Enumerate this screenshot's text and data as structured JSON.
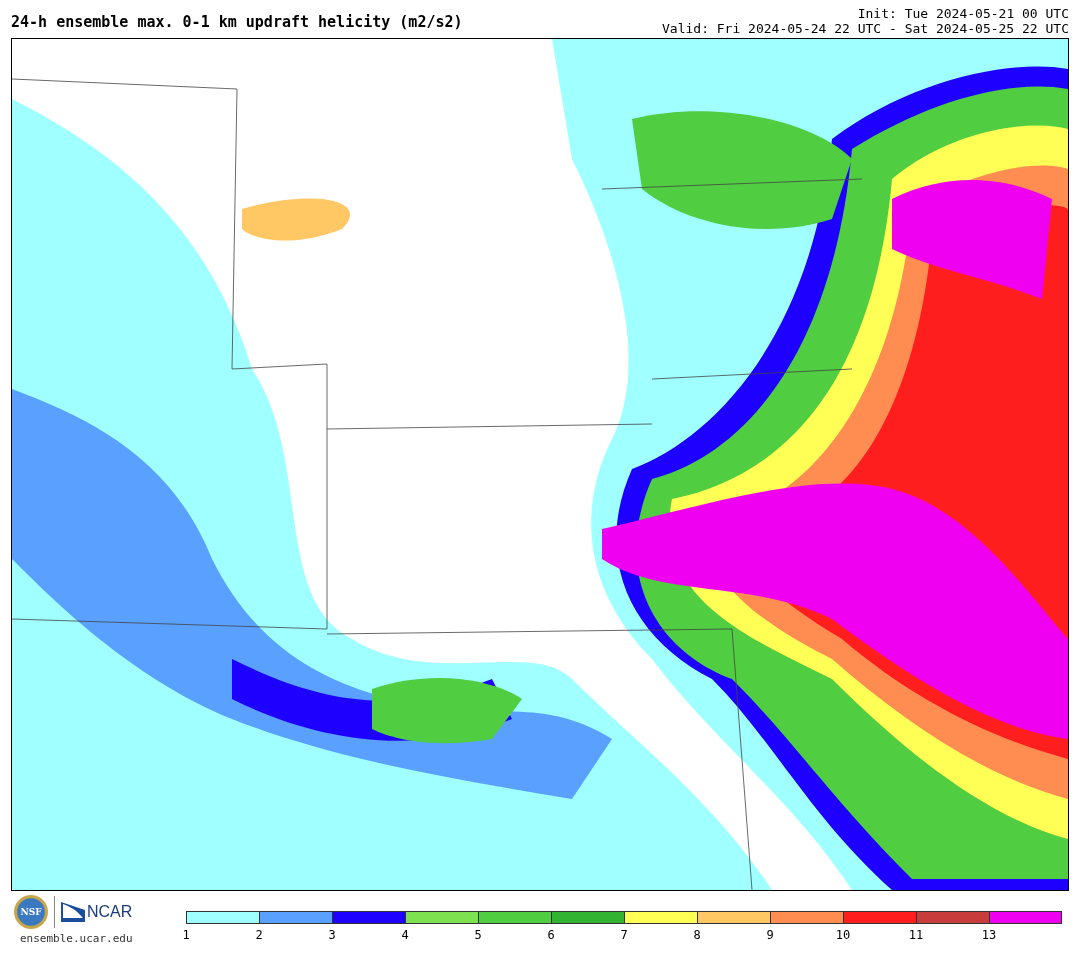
{
  "title": "24-h ensemble max. 0-1 km updraft helicity (m2/s2)",
  "init": "Init: Tue 2024-05-21 00 UTC",
  "valid": "Valid: Fri 2024-05-24 22 UTC - Sat 2024-05-25 22 UTC",
  "logos": {
    "nsf": "NSF",
    "ncar": "NCAR",
    "site": "ensemble.ucar.edu"
  },
  "legend": [
    {
      "label": "1",
      "color": "#a0ffff"
    },
    {
      "label": "2",
      "color": "#5aa0ff"
    },
    {
      "label": "3",
      "color": "#1e00ff"
    },
    {
      "label": "4",
      "color": "#7de150"
    },
    {
      "label": "5",
      "color": "#50cd40"
    },
    {
      "label": "6",
      "color": "#32b432"
    },
    {
      "label": "7",
      "color": "#ffff55"
    },
    {
      "label": "8",
      "color": "#ffc864"
    },
    {
      "label": "9",
      "color": "#ff8c50"
    },
    {
      "label": "10",
      "color": "#ff1e1e"
    },
    {
      "label": "11",
      "color": "#c83c3c"
    },
    {
      "label": "13",
      "color": "#f000f0"
    }
  ]
}
